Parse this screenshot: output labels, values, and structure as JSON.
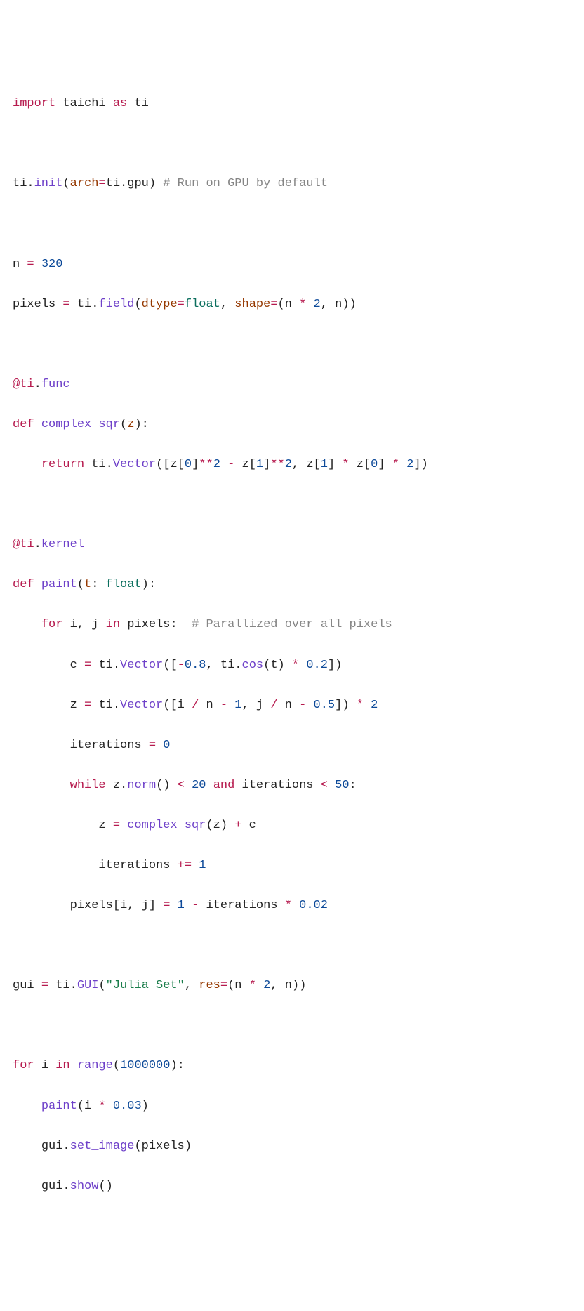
{
  "code": {
    "line1": {
      "import": "import",
      "taichi": "taichi",
      "as": "as",
      "ti": "ti"
    },
    "line3": {
      "ti_init": "ti",
      "dot": ".",
      "init": "init",
      "lparen": "(",
      "arch": "arch",
      "eq": "=",
      "ti2": "ti",
      "dot2": ".",
      "gpu": "gpu",
      "rparen": ")",
      "comment": "# Run on GPU by default"
    },
    "line5": {
      "n": "n",
      "eq": "=",
      "val": "320"
    },
    "line6": {
      "pixels": "pixels",
      "eq": "=",
      "ti": "ti",
      "dot": ".",
      "field": "field",
      "lparen": "(",
      "dtype": "dtype",
      "eq2": "=",
      "float": "float",
      "comma": ",",
      "shape": "shape",
      "eq3": "=",
      "lparen2": "(",
      "n1": "n",
      "star": "*",
      "two": "2",
      "comma2": ",",
      "n2": "n",
      "rparen2": ")",
      "rparen": ")"
    },
    "line8": {
      "at": "@ti",
      "dot": ".",
      "func": "func"
    },
    "line9": {
      "def": "def",
      "name": "complex_sqr",
      "lparen": "(",
      "z": "z",
      "rparen": "):"
    },
    "line10": {
      "return": "return",
      "ti": "ti",
      "dot": ".",
      "vector": "Vector",
      "lparen": "([",
      "z1": "z",
      "lb1": "[",
      "zero1": "0",
      "rb1": "]",
      "pow1": "**",
      "two1": "2",
      "minus": "-",
      "z2": "z",
      "lb2": "[",
      "one1": "1",
      "rb2": "]",
      "pow2": "**",
      "two2": "2",
      "comma": ",",
      "z3": "z",
      "lb3": "[",
      "one2": "1",
      "rb3": "]",
      "star1": "*",
      "z4": "z",
      "lb4": "[",
      "zero2": "0",
      "rb4": "]",
      "star2": "*",
      "two3": "2",
      "rparen": "])"
    },
    "line12": {
      "at": "@ti",
      "dot": ".",
      "kernel": "kernel"
    },
    "line13": {
      "def": "def",
      "name": "paint",
      "lparen": "(",
      "t": "t",
      "colon": ":",
      "float": "float",
      "rparen": "):"
    },
    "line14": {
      "for": "for",
      "i": "i",
      "comma": ",",
      "j": "j",
      "in": "in",
      "pixels": "pixels",
      "colon": ":",
      "comment": "# Parallized over all pixels"
    },
    "line15": {
      "c": "c",
      "eq": "=",
      "ti": "ti",
      "dot": ".",
      "vector": "Vector",
      "lparen": "([",
      "neg": "-",
      "v1": "0.8",
      "comma": ",",
      "ti2": "ti",
      "dot2": ".",
      "cos": "cos",
      "lparen2": "(",
      "t": "t",
      "rparen2": ")",
      "star": "*",
      "v2": "0.2",
      "rparen": "])"
    },
    "line16": {
      "z": "z",
      "eq": "=",
      "ti": "ti",
      "dot": ".",
      "vector": "Vector",
      "lparen": "([",
      "i": "i",
      "div1": "/",
      "n1": "n",
      "minus1": "-",
      "one": "1",
      "comma": ",",
      "j": "j",
      "div2": "/",
      "n2": "n",
      "minus2": "-",
      "half": "0.5",
      "rparen": "])",
      "star": "*",
      "two": "2"
    },
    "line17": {
      "iterations": "iterations",
      "eq": "=",
      "zero": "0"
    },
    "line18": {
      "while": "while",
      "z": "z",
      "dot": ".",
      "norm": "norm",
      "parens": "()",
      "lt": "<",
      "twenty": "20",
      "and": "and",
      "iterations": "iterations",
      "lt2": "<",
      "fifty": "50",
      "colon": ":"
    },
    "line19": {
      "z": "z",
      "eq": "=",
      "complex_sqr": "complex_sqr",
      "lparen": "(",
      "z2": "z",
      "rparen": ")",
      "plus": "+",
      "c": "c"
    },
    "line20": {
      "iterations": "iterations",
      "pluseq": "+=",
      "one": "1"
    },
    "line21": {
      "pixels": "pixels",
      "lb": "[",
      "i": "i",
      "comma": ",",
      "j": "j",
      "rb": "]",
      "eq": "=",
      "one": "1",
      "minus": "-",
      "iterations": "iterations",
      "star": "*",
      "val": "0.02"
    },
    "line23": {
      "gui": "gui",
      "eq": "=",
      "ti": "ti",
      "dot": ".",
      "GUI": "GUI",
      "lparen": "(",
      "str": "\"Julia Set\"",
      "comma": ",",
      "res": "res",
      "eq2": "=",
      "lparen2": "(",
      "n1": "n",
      "star": "*",
      "two": "2",
      "comma2": ",",
      "n2": "n",
      "rparen2": ")",
      "rparen": ")"
    },
    "line25": {
      "for": "for",
      "i": "i",
      "in": "in",
      "range": "range",
      "lparen": "(",
      "val": "1000000",
      "rparen": "):"
    },
    "line26": {
      "paint": "paint",
      "lparen": "(",
      "i": "i",
      "star": "*",
      "val": "0.03",
      "rparen": ")"
    },
    "line27": {
      "gui": "gui",
      "dot": ".",
      "set_image": "set_image",
      "lparen": "(",
      "pixels": "pixels",
      "rparen": ")"
    },
    "line28": {
      "gui": "gui",
      "dot": ".",
      "show": "show",
      "parens": "()"
    }
  }
}
